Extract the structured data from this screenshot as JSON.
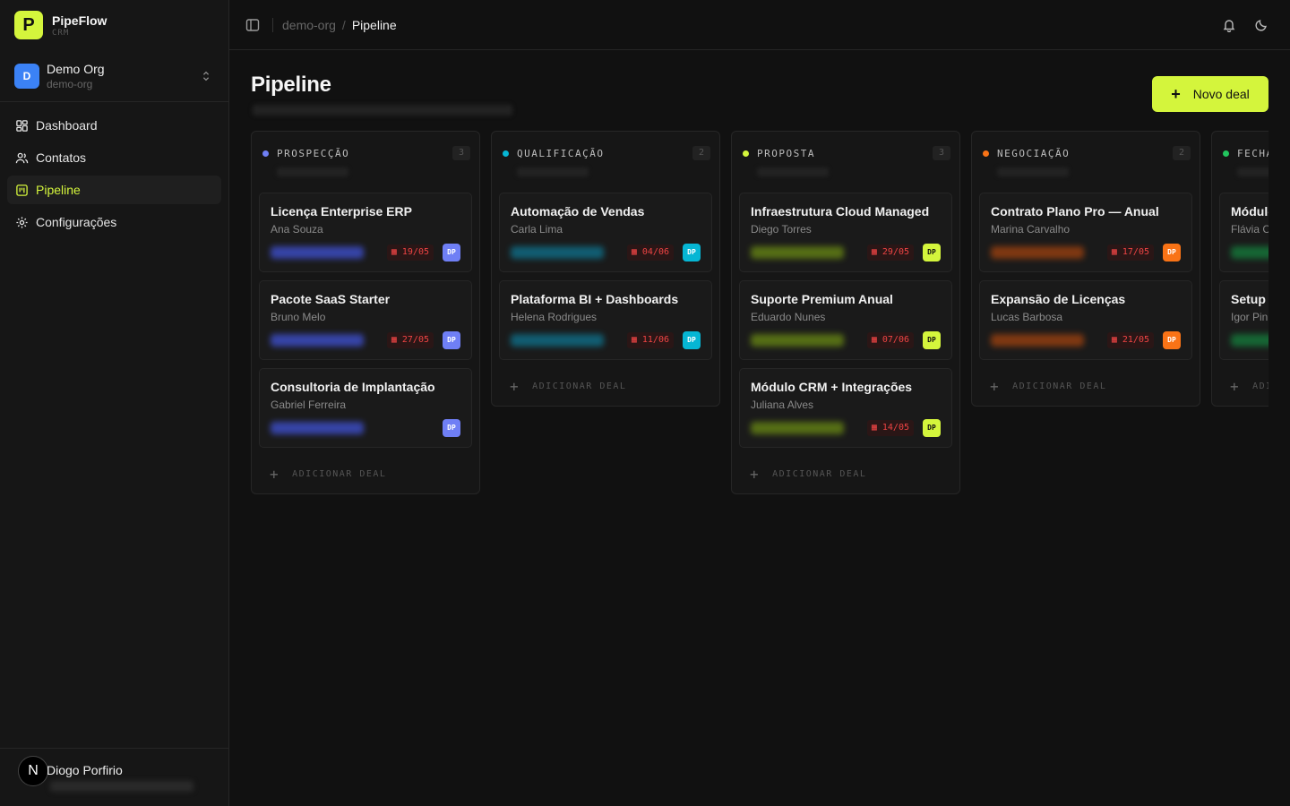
{
  "brand": {
    "name": "PipeFlow",
    "sub": "CRM",
    "logo_letter": "P",
    "accent": "#d4f53c"
  },
  "org": {
    "initial": "D",
    "name": "Demo Org",
    "slug": "demo-org"
  },
  "nav": [
    {
      "label": "Dashboard",
      "icon": "dashboard-icon",
      "active": false
    },
    {
      "label": "Contatos",
      "icon": "users-icon",
      "active": false
    },
    {
      "label": "Pipeline",
      "icon": "kanban-icon",
      "active": true
    },
    {
      "label": "Configurações",
      "icon": "gear-icon",
      "active": false
    }
  ],
  "user": {
    "initial": "N",
    "name": "Diogo Porfirio"
  },
  "breadcrumb": {
    "root": "demo-org",
    "sep": "/",
    "current": "Pipeline"
  },
  "page": {
    "title": "Pipeline",
    "new_deal": "Novo deal"
  },
  "add_label": "ADICIONAR DEAL",
  "columns": [
    {
      "name": "PROSPECÇÃO",
      "count": "3",
      "color": "#6f7ff5",
      "cards": [
        {
          "title": "Licença Enterprise ERP",
          "contact": "Ana Souza",
          "date": "19/05",
          "owner": "DP"
        },
        {
          "title": "Pacote SaaS Starter",
          "contact": "Bruno Melo",
          "date": "27/05",
          "owner": "DP"
        },
        {
          "title": "Consultoria de Implantação",
          "contact": "Gabriel Ferreira",
          "date": "",
          "owner": "DP"
        }
      ]
    },
    {
      "name": "QUALIFICAÇÃO",
      "count": "2",
      "color": "#06b6d4",
      "cards": [
        {
          "title": "Automação de Vendas",
          "contact": "Carla Lima",
          "date": "04/06",
          "owner": "DP"
        },
        {
          "title": "Plataforma BI + Dashboards",
          "contact": "Helena Rodrigues",
          "date": "11/06",
          "owner": "DP"
        }
      ]
    },
    {
      "name": "PROPOSTA",
      "count": "3",
      "color": "#d4f53c",
      "cards": [
        {
          "title": "Infraestrutura Cloud Managed",
          "contact": "Diego Torres",
          "date": "29/05",
          "owner": "DP"
        },
        {
          "title": "Suporte Premium Anual",
          "contact": "Eduardo Nunes",
          "date": "07/06",
          "owner": "DP"
        },
        {
          "title": "Módulo CRM + Integrações",
          "contact": "Juliana Alves",
          "date": "14/05",
          "owner": "DP"
        }
      ]
    },
    {
      "name": "NEGOCIAÇÃO",
      "count": "2",
      "color": "#f97316",
      "cards": [
        {
          "title": "Contrato Plano Pro — Anual",
          "contact": "Marina Carvalho",
          "date": "17/05",
          "owner": "DP"
        },
        {
          "title": "Expansão de Licenças",
          "contact": "Lucas Barbosa",
          "date": "21/05",
          "owner": "DP"
        }
      ]
    },
    {
      "name": "FECHADO",
      "count": "",
      "color": "#22c55e",
      "cards": [
        {
          "title": "Módulo",
          "contact": "Flávia C",
          "date": "",
          "owner": ""
        },
        {
          "title": "Setup Comp",
          "contact": "Igor Pin",
          "date": "",
          "owner": ""
        }
      ]
    }
  ]
}
